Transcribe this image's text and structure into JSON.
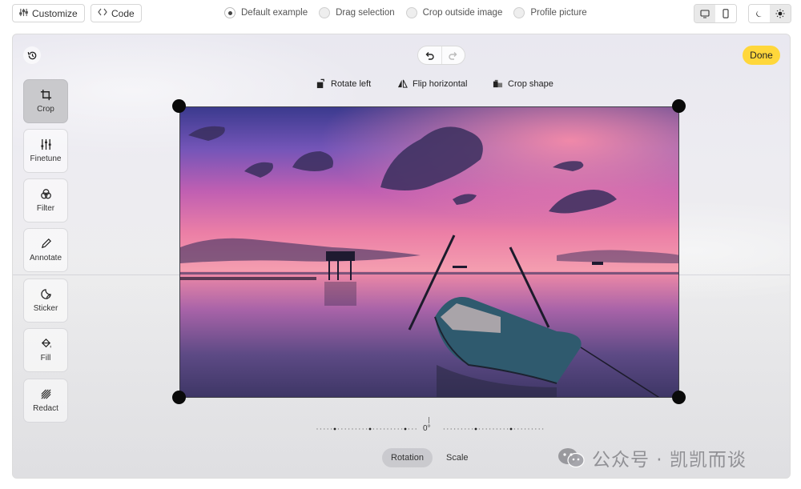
{
  "topbar": {
    "customize_label": "Customize",
    "code_label": "Code",
    "examples": [
      {
        "label": "Default example",
        "selected": true
      },
      {
        "label": "Drag selection",
        "selected": false
      },
      {
        "label": "Crop outside image",
        "selected": false
      },
      {
        "label": "Profile picture",
        "selected": false
      }
    ],
    "device_modes": [
      "desktop-icon",
      "mobile-icon"
    ],
    "theme_modes": [
      "moon-icon",
      "sun-icon"
    ]
  },
  "editor": {
    "done_label": "Done",
    "tools": [
      {
        "label": "Crop",
        "icon": "crop-icon",
        "active": true
      },
      {
        "label": "Finetune",
        "icon": "sliders-icon",
        "active": false
      },
      {
        "label": "Filter",
        "icon": "filter-icon",
        "active": false
      },
      {
        "label": "Annotate",
        "icon": "pencil-icon",
        "active": false
      },
      {
        "label": "Sticker",
        "icon": "sticker-icon",
        "active": false
      },
      {
        "label": "Fill",
        "icon": "fill-icon",
        "active": false
      },
      {
        "label": "Redact",
        "icon": "redact-icon",
        "active": false
      }
    ],
    "crop_actions": {
      "rotate_left": "Rotate left",
      "flip_horizontal": "Flip horizontal",
      "crop_shape": "Crop shape"
    },
    "rotation_value": "0°",
    "mode_tabs": [
      {
        "label": "Rotation",
        "active": true
      },
      {
        "label": "Scale",
        "active": false
      }
    ],
    "accent_color": "#ffd73b"
  },
  "watermark": {
    "text": "公众号 · 凯凯而谈"
  }
}
